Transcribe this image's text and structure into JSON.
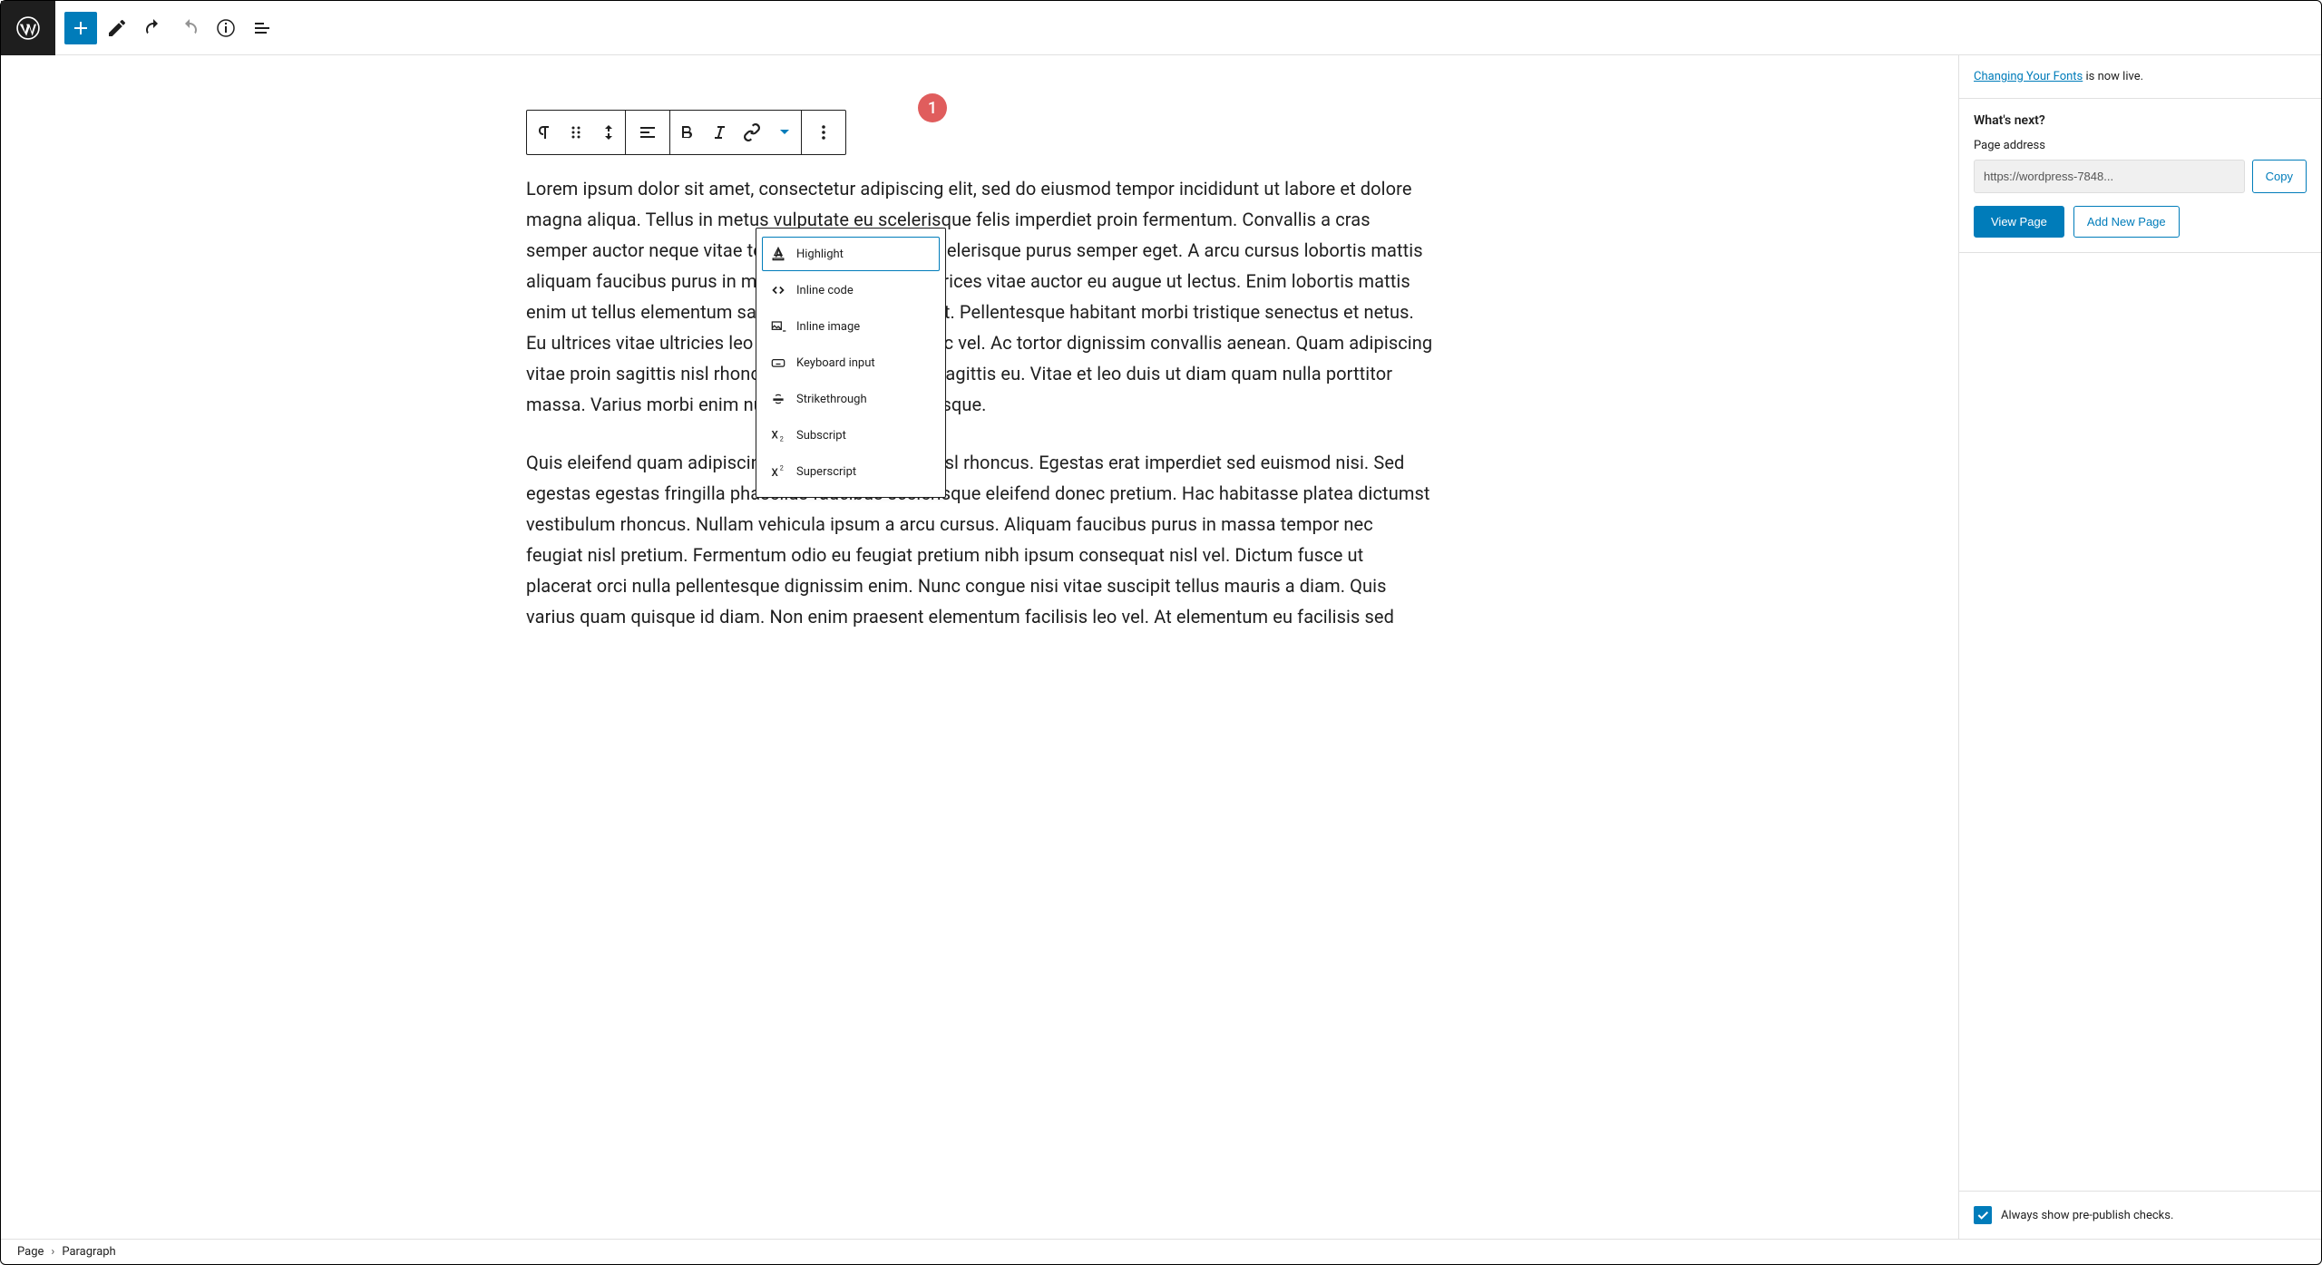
{
  "toolbar": {},
  "blockToolbar": {},
  "badge": "1",
  "dropdown": {
    "items": [
      {
        "label": "Highlight"
      },
      {
        "label": "Inline code"
      },
      {
        "label": "Inline image"
      },
      {
        "label": "Keyboard input"
      },
      {
        "label": "Strikethrough"
      },
      {
        "label": "Subscript"
      },
      {
        "label": "Superscript"
      }
    ]
  },
  "content": {
    "para1": "Lorem ipsum dolor sit amet, consectetur adipiscing elit, sed do eiusmod tempor incididunt ut labore et dolore magna aliqua. Tellus in metus vulputate eu scelerisque felis imperdiet proin fermentum. Convallis a cras semper auctor neque vitae tempus sagittis orci a scelerisque purus semper eget. A arcu cursus lobortis mattis aliquam faucibus purus in massa tempor nec eu ultrices vitae auctor eu augue ut lectus. Enim lobortis mattis enim ut tellus elementum sagittis. Pellentesque velit. Pellentesque habitant morbi tristique senectus et netus. Eu ultrices vitae ultricies leo integer malesuada nunc vel. Ac tortor dignissim convallis aenean. Quam adipiscing vitae proin sagittis nisl rhoncus. Quam viverra orci sagittis eu. Vitae et leo duis ut diam quam nulla porttitor massa. Varius morbi enim nunc faucibus a pellentesque.",
    "para2": "Quis eleifend quam adipiscing vitae proin sagittis nisl rhoncus. Egestas erat imperdiet sed euismod nisi. Sed egestas egestas fringilla phasellus faucibus scelerisque eleifend donec pretium. Hac habitasse platea dictumst vestibulum rhoncus. Nullam vehicula ipsum a arcu cursus. Aliquam faucibus purus in massa tempor nec feugiat nisl pretium. Fermentum odio eu feugiat pretium nibh ipsum consequat nisl vel. Dictum fusce ut placerat orci nulla pellentesque dignissim enim. Nunc congue nisi vitae suscipit tellus mauris a diam. Quis varius quam quisque id diam. Non enim praesent elementum facilisis leo vel. At elementum eu facilisis sed"
  },
  "sidebar": {
    "link_text": "Changing Your Fonts",
    "live_text": " is now live.",
    "whats_next": "What's next?",
    "page_address_label": "Page address",
    "page_address": "https://wordpress-7848...",
    "copy": "Copy",
    "view_page": "View Page",
    "add_new_page": "Add New Page",
    "pre_publish": "Always show pre-publish checks."
  },
  "footer": {
    "crumb1": "Page",
    "crumb2": "Paragraph"
  }
}
